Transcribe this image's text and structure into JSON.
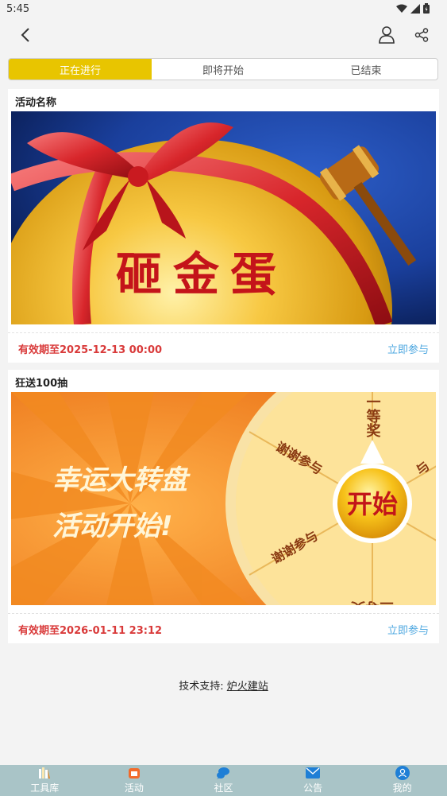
{
  "status_bar": {
    "time": "5:45"
  },
  "tabs": [
    {
      "label": "正在进行",
      "active": true
    },
    {
      "label": "即将开始",
      "active": false
    },
    {
      "label": "已结束",
      "active": false
    }
  ],
  "activities": [
    {
      "title": "活动名称",
      "banner_text": "砸金蛋",
      "valid_until": "有效期至2025-12-13 00:00",
      "join_label": "立即参与"
    },
    {
      "title": "狂送100抽",
      "banner_line1": "幸运大转盘",
      "banner_line2": "活动开始!",
      "wheel_button": "开始",
      "wheel_prizes": [
        "一等奖",
        "谢谢参与",
        "谢谢参与",
        "三等奖",
        "与"
      ],
      "valid_until": "有效期至2026-01-11 23:12",
      "join_label": "立即参与"
    }
  ],
  "footer": {
    "prefix": "技术支持:",
    "link": "炉火建站"
  },
  "bottom_nav": [
    {
      "label": "工具库",
      "icon": "toolbox-icon"
    },
    {
      "label": "活动",
      "icon": "activity-icon"
    },
    {
      "label": "社区",
      "icon": "chat-icon"
    },
    {
      "label": "公告",
      "icon": "mail-icon"
    },
    {
      "label": "我的",
      "icon": "user-icon"
    }
  ],
  "colors": {
    "tab_active": "#e8c500",
    "valid_red": "#d93a3a",
    "join_blue": "#4fa8e0",
    "bottom_bar": "#a9c4c7"
  }
}
